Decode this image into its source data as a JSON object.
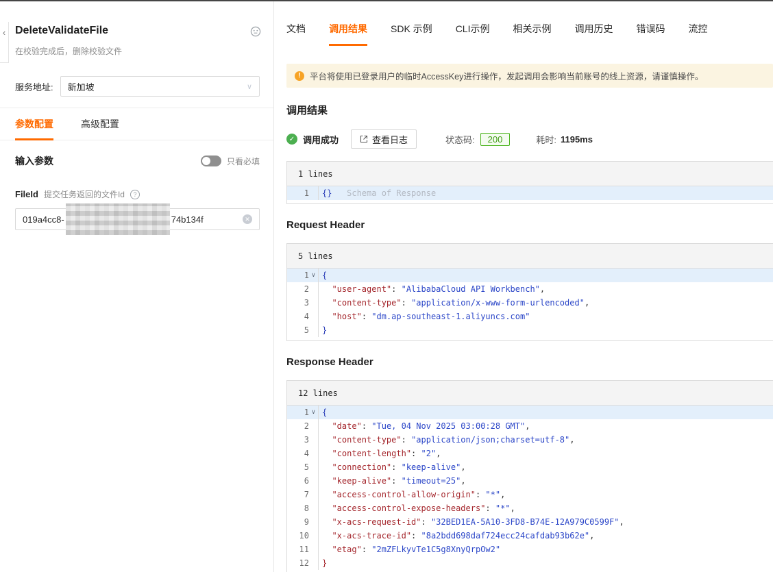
{
  "icons": {
    "back": "‹",
    "chevron_down": "∨",
    "fold": "∨",
    "help": "?",
    "clear": "✕",
    "warning": "!",
    "check": "✓"
  },
  "colors": {
    "accent_orange": "#FF6A00",
    "success_green": "#4CAF50",
    "badge_green_border": "#4DB520",
    "warning_bg": "#FBF4E1",
    "warning_icon": "#F7A326",
    "code_key": "#A4262C",
    "code_string": "#2B46C8",
    "active_line_bg": "#E3EFFB"
  },
  "left_panel": {
    "title": "DeleteValidateFile",
    "subtitle": "在校验完成后，删除校验文件",
    "endpoint_label": "服务地址:",
    "endpoint_value": "新加坡",
    "tabs": [
      {
        "label": "参数配置",
        "active": true
      },
      {
        "label": "高级配置",
        "active": false
      }
    ],
    "input_params_title": "输入参数",
    "required_only_label": "只看必填",
    "field": {
      "name": "FileId",
      "desc": "提交任务返回的文件Id",
      "value_prefix": "019a4cc8-",
      "value_suffix": "74b134f"
    }
  },
  "main": {
    "tabs": [
      {
        "label": "文档",
        "active": false
      },
      {
        "label": "调用结果",
        "active": true
      },
      {
        "label": "SDK 示例",
        "active": false
      },
      {
        "label": "CLI示例",
        "active": false
      },
      {
        "label": "相关示例",
        "active": false
      },
      {
        "label": "调用历史",
        "active": false
      },
      {
        "label": "错误码",
        "active": false
      },
      {
        "label": "流控",
        "active": false
      }
    ],
    "warning_text": "平台将使用已登录用户的临时AccessKey进行操作，发起调用会影响当前账号的线上资源，请谨慎操作。",
    "result_title": "调用结果",
    "status": {
      "success_label": "调用成功",
      "view_log_label": "查看日志",
      "status_code_label": "状态码:",
      "status_code": "200",
      "duration_label": "耗时:",
      "duration_value": "1195ms"
    },
    "request_header_title": "Request Header",
    "response_header_title": "Response Header",
    "blocks": {
      "schema": {
        "lines_label": "1 lines",
        "lines": [
          {
            "n": 1,
            "hl": true,
            "tokens": [
              {
                "t": "{}",
                "c": "blue"
              },
              {
                "t": "   Schema of Response",
                "c": "ph"
              }
            ]
          }
        ]
      },
      "request": {
        "lines_label": "5 lines",
        "lines": [
          {
            "n": 1,
            "hl": true,
            "fold": true,
            "tokens": [
              {
                "t": "{",
                "c": "blue"
              }
            ]
          },
          {
            "n": 2,
            "tokens": [
              {
                "t": "  ",
                "c": "p"
              },
              {
                "t": "\"user-agent\"",
                "c": "key"
              },
              {
                "t": ": ",
                "c": "p"
              },
              {
                "t": "\"AlibabaCloud API Workbench\"",
                "c": "str"
              },
              {
                "t": ",",
                "c": "p"
              }
            ]
          },
          {
            "n": 3,
            "tokens": [
              {
                "t": "  ",
                "c": "p"
              },
              {
                "t": "\"content-type\"",
                "c": "key"
              },
              {
                "t": ": ",
                "c": "p"
              },
              {
                "t": "\"application/x-www-form-urlencoded\"",
                "c": "str"
              },
              {
                "t": ",",
                "c": "p"
              }
            ]
          },
          {
            "n": 4,
            "tokens": [
              {
                "t": "  ",
                "c": "p"
              },
              {
                "t": "\"host\"",
                "c": "key"
              },
              {
                "t": ": ",
                "c": "p"
              },
              {
                "t": "\"dm.ap-southeast-1.aliyuncs.com\"",
                "c": "str"
              }
            ]
          },
          {
            "n": 5,
            "tokens": [
              {
                "t": "}",
                "c": "blue"
              }
            ]
          }
        ]
      },
      "response": {
        "lines_label": "12 lines",
        "lines": [
          {
            "n": 1,
            "hl": true,
            "fold": true,
            "tokens": [
              {
                "t": "{",
                "c": "blue"
              }
            ]
          },
          {
            "n": 2,
            "tokens": [
              {
                "t": "  ",
                "c": "p"
              },
              {
                "t": "\"date\"",
                "c": "key"
              },
              {
                "t": ": ",
                "c": "p"
              },
              {
                "t": "\"Tue, 04 Nov 2025 03:00:28 GMT\"",
                "c": "str"
              },
              {
                "t": ",",
                "c": "p"
              }
            ]
          },
          {
            "n": 3,
            "tokens": [
              {
                "t": "  ",
                "c": "p"
              },
              {
                "t": "\"content-type\"",
                "c": "key"
              },
              {
                "t": ": ",
                "c": "p"
              },
              {
                "t": "\"application/json;charset=utf-8\"",
                "c": "str"
              },
              {
                "t": ",",
                "c": "p"
              }
            ]
          },
          {
            "n": 4,
            "tokens": [
              {
                "t": "  ",
                "c": "p"
              },
              {
                "t": "\"content-length\"",
                "c": "key"
              },
              {
                "t": ": ",
                "c": "p"
              },
              {
                "t": "\"2\"",
                "c": "str"
              },
              {
                "t": ",",
                "c": "p"
              }
            ]
          },
          {
            "n": 5,
            "tokens": [
              {
                "t": "  ",
                "c": "p"
              },
              {
                "t": "\"connection\"",
                "c": "key"
              },
              {
                "t": ": ",
                "c": "p"
              },
              {
                "t": "\"keep-alive\"",
                "c": "str"
              },
              {
                "t": ",",
                "c": "p"
              }
            ]
          },
          {
            "n": 6,
            "tokens": [
              {
                "t": "  ",
                "c": "p"
              },
              {
                "t": "\"keep-alive\"",
                "c": "key"
              },
              {
                "t": ": ",
                "c": "p"
              },
              {
                "t": "\"timeout=25\"",
                "c": "str"
              },
              {
                "t": ",",
                "c": "p"
              }
            ]
          },
          {
            "n": 7,
            "tokens": [
              {
                "t": "  ",
                "c": "p"
              },
              {
                "t": "\"access-control-allow-origin\"",
                "c": "key"
              },
              {
                "t": ": ",
                "c": "p"
              },
              {
                "t": "\"*\"",
                "c": "str"
              },
              {
                "t": ",",
                "c": "p"
              }
            ]
          },
          {
            "n": 8,
            "tokens": [
              {
                "t": "  ",
                "c": "p"
              },
              {
                "t": "\"access-control-expose-headers\"",
                "c": "key"
              },
              {
                "t": ": ",
                "c": "p"
              },
              {
                "t": "\"*\"",
                "c": "str"
              },
              {
                "t": ",",
                "c": "p"
              }
            ]
          },
          {
            "n": 9,
            "tokens": [
              {
                "t": "  ",
                "c": "p"
              },
              {
                "t": "\"x-acs-request-id\"",
                "c": "key"
              },
              {
                "t": ": ",
                "c": "p"
              },
              {
                "t": "\"32BED1EA-5A10-3FD8-B74E-12A979C0599F\"",
                "c": "str"
              },
              {
                "t": ",",
                "c": "p"
              }
            ]
          },
          {
            "n": 10,
            "tokens": [
              {
                "t": "  ",
                "c": "p"
              },
              {
                "t": "\"x-acs-trace-id\"",
                "c": "key"
              },
              {
                "t": ": ",
                "c": "p"
              },
              {
                "t": "\"8a2bdd698daf724ecc24cafdab93b62e\"",
                "c": "str"
              },
              {
                "t": ",",
                "c": "p"
              }
            ]
          },
          {
            "n": 11,
            "tokens": [
              {
                "t": "  ",
                "c": "p"
              },
              {
                "t": "\"etag\"",
                "c": "key"
              },
              {
                "t": ": ",
                "c": "p"
              },
              {
                "t": "\"2mZFLkyvTe1C5g8XnyQrpOw2\"",
                "c": "str"
              }
            ]
          },
          {
            "n": 12,
            "tokens": [
              {
                "t": "}",
                "c": "red"
              }
            ]
          }
        ]
      }
    }
  }
}
